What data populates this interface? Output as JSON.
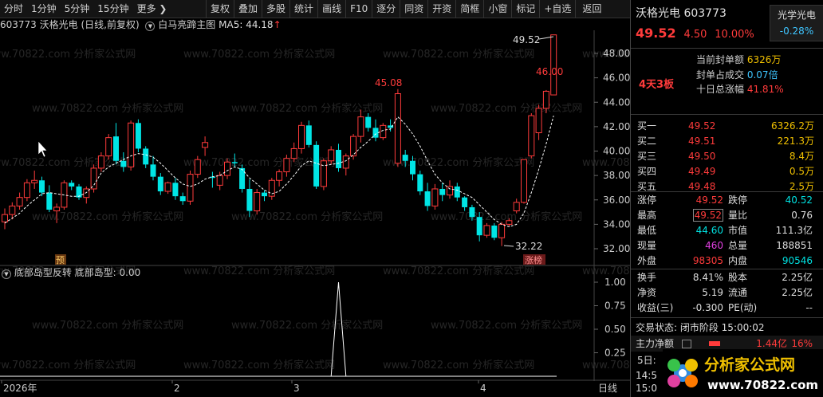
{
  "toolbar": {
    "left": [
      "分时",
      "1分钟",
      "5分钟",
      "15分钟",
      "更多 ❯"
    ],
    "right": [
      "复权",
      "叠加",
      "多股",
      "统计",
      "画线",
      "F10",
      "逐分",
      "同资",
      "开资",
      "简框",
      "小窗",
      "标记",
      "+自选",
      "返回"
    ]
  },
  "chart": {
    "code": "603773",
    "name_label": "沃格光电 (日线,前复权)",
    "formula": "白马亮蹄主图",
    "ma_label": "MA5: 44.18",
    "ma_arrow": "↑",
    "y_ticks": [
      "48.00",
      "46.00",
      "44.00",
      "42.00",
      "40.00",
      "38.00",
      "36.00",
      "34.00",
      "32.00"
    ],
    "annotations": {
      "high": "45.08",
      "top": "49.52",
      "mid": "46.00",
      "low": "32.22"
    },
    "badges": {
      "yu": "预",
      "zhangbang": "涨榜"
    }
  },
  "indicator": {
    "name": "底部岛型反转",
    "value_label": "底部岛型: 0.00",
    "y_ticks": [
      "1.00",
      "0.75",
      "0.50",
      "0.25"
    ]
  },
  "xaxis": {
    "labels": [
      "2026年",
      "2",
      "3",
      "4"
    ],
    "right_label": "日线"
  },
  "chart_data": {
    "type": "candlestick",
    "ylim": [
      31.5,
      49.5
    ],
    "ohlc": [
      [
        34.2,
        35.3,
        33.6,
        34.8
      ],
      [
        34.8,
        35.8,
        34.4,
        35.5
      ],
      [
        35.5,
        36.6,
        35.2,
        36.2
      ],
      [
        36.2,
        37.7,
        35.9,
        37.4
      ],
      [
        37.4,
        38.4,
        36.9,
        37.6
      ],
      [
        37.6,
        37.9,
        36.3,
        36.6
      ],
      [
        36.6,
        37.2,
        35.0,
        35.2
      ],
      [
        35.1,
        35.7,
        34.1,
        35.4
      ],
      [
        35.4,
        37.6,
        35.2,
        37.4
      ],
      [
        37.4,
        37.6,
        36.8,
        37.1
      ],
      [
        37.1,
        37.3,
        36.0,
        36.2
      ],
      [
        36.2,
        37.1,
        35.7,
        36.9
      ],
      [
        36.9,
        38.9,
        36.6,
        38.6
      ],
      [
        38.6,
        39.9,
        38.3,
        39.6
      ],
      [
        39.6,
        41.4,
        39.3,
        41.1
      ],
      [
        41.2,
        42.3,
        38.9,
        39.2
      ],
      [
        39.2,
        39.9,
        38.3,
        38.7
      ],
      [
        38.7,
        42.5,
        38.4,
        42.3
      ],
      [
        42.3,
        42.6,
        39.9,
        40.2
      ],
      [
        40.2,
        40.4,
        38.6,
        38.9
      ],
      [
        38.9,
        39.6,
        37.6,
        37.9
      ],
      [
        37.9,
        38.2,
        36.4,
        36.7
      ],
      [
        36.7,
        37.5,
        36.5,
        37.4
      ],
      [
        37.4,
        37.8,
        36.0,
        36.3
      ],
      [
        36.3,
        36.6,
        35.6,
        35.9
      ],
      [
        35.9,
        38.4,
        35.6,
        38.1
      ],
      [
        38.1,
        39.6,
        37.8,
        39.3
      ],
      [
        40.3,
        41.2,
        39.6,
        40.7
      ],
      [
        37.9,
        38.3,
        37.0,
        37.8
      ],
      [
        37.2,
        38.3,
        36.8,
        38.0
      ],
      [
        38.0,
        39.4,
        37.7,
        39.1
      ],
      [
        39.1,
        39.8,
        38.7,
        39.0
      ],
      [
        38.6,
        38.9,
        36.6,
        36.9
      ],
      [
        36.9,
        37.7,
        34.6,
        35.1
      ],
      [
        35.1,
        36.9,
        34.8,
        36.6
      ],
      [
        36.6,
        36.8,
        35.9,
        36.3
      ],
      [
        36.3,
        37.8,
        36.0,
        37.6
      ],
      [
        37.6,
        38.5,
        37.1,
        38.3
      ],
      [
        38.3,
        39.7,
        37.9,
        39.4
      ],
      [
        39.4,
        40.7,
        39.1,
        40.2
      ],
      [
        40.2,
        42.4,
        39.8,
        42.1
      ],
      [
        42.1,
        42.5,
        40.3,
        40.5
      ],
      [
        40.5,
        40.8,
        36.9,
        37.1
      ],
      [
        37.1,
        39.4,
        36.8,
        39.2
      ],
      [
        39.2,
        40.4,
        38.9,
        40.1
      ],
      [
        40.1,
        40.6,
        38.3,
        38.6
      ],
      [
        38.6,
        39.8,
        38.0,
        39.6
      ],
      [
        39.6,
        41.4,
        39.3,
        41.2
      ],
      [
        41.2,
        43.4,
        40.7,
        42.8
      ],
      [
        42.8,
        43.1,
        41.6,
        41.9
      ],
      [
        41.9,
        42.6,
        40.8,
        41.1
      ],
      [
        41.1,
        42.3,
        40.9,
        42.1
      ],
      [
        42.1,
        42.6,
        41.6,
        41.9
      ],
      [
        39.0,
        45.08,
        38.7,
        44.7
      ],
      [
        39.7,
        40.1,
        38.7,
        39.2
      ],
      [
        39.2,
        39.6,
        37.6,
        38.1
      ],
      [
        38.1,
        38.4,
        36.4,
        36.7
      ],
      [
        36.7,
        37.4,
        35.1,
        35.5
      ],
      [
        35.5,
        37.3,
        35.2,
        36.9
      ],
      [
        36.9,
        37.4,
        35.9,
        36.4
      ],
      [
        36.4,
        37.6,
        36.1,
        37.1
      ],
      [
        37.1,
        37.4,
        35.9,
        36.2
      ],
      [
        36.2,
        36.3,
        35.1,
        35.4
      ],
      [
        35.4,
        35.6,
        34.3,
        34.6
      ],
      [
        34.6,
        35.0,
        32.6,
        33.1
      ],
      [
        33.1,
        34.1,
        32.9,
        33.9
      ],
      [
        33.9,
        34.1,
        32.7,
        32.9
      ],
      [
        32.9,
        34.2,
        32.22,
        34.0
      ],
      [
        34.0,
        34.5,
        33.8,
        34.3
      ],
      [
        35.1,
        36.1,
        34.9,
        35.8
      ],
      [
        35.8,
        39.3,
        35.7,
        39.3
      ],
      [
        39.6,
        43.1,
        39.4,
        42.9
      ],
      [
        41.5,
        43.8,
        40.9,
        43.5
      ],
      [
        43.5,
        45.0,
        43.1,
        44.9
      ],
      [
        44.6,
        49.52,
        44.6,
        49.52
      ]
    ],
    "ma5": [
      34.1,
      34.5,
      34.9,
      35.5,
      36.0,
      36.5,
      36.6,
      36.5,
      36.4,
      36.3,
      36.3,
      36.6,
      37.2,
      38.2,
      38.7,
      39.0,
      39.3,
      39.6,
      39.8,
      39.7,
      39.5,
      39.0,
      38.4,
      37.8,
      37.3,
      37.1,
      37.3,
      37.7,
      37.9,
      38.0,
      38.4,
      38.7,
      38.5,
      37.8,
      37.3,
      36.8,
      36.5,
      36.7,
      37.3,
      38.0,
      38.8,
      39.2,
      39.0,
      38.8,
      38.9,
      39.0,
      39.2,
      39.7,
      40.3,
      40.8,
      41.4,
      41.7,
      41.8,
      42.8,
      42.2,
      41.4,
      40.4,
      39.2,
      38.1,
      37.4,
      36.9,
      36.8,
      36.5,
      36.2,
      35.6,
      35.0,
      34.4,
      34.0,
      33.8,
      34.0,
      34.9,
      36.6,
      38.5,
      40.6,
      42.9
    ],
    "indicator": {
      "name": "底部岛型",
      "values_nonzero": {
        "45": 1.0
      },
      "ylim": [
        0,
        1.1
      ]
    }
  },
  "panel": {
    "stock_name": "沃格光电",
    "code": "603773",
    "sector": "光学光电",
    "sector_change": "-0.28%",
    "price": "49.52",
    "change": "4.50",
    "pct": "10.00%",
    "streak": "4天3板",
    "seal": [
      {
        "label": "当前封单额",
        "value": "6326万"
      },
      {
        "label": "封单占成交",
        "value": "0.07倍"
      },
      {
        "label": "十日总涨幅",
        "value": "41.81%"
      }
    ],
    "orderbook": [
      {
        "name": "买一",
        "price": "49.52",
        "vol": "6326.2万"
      },
      {
        "name": "买二",
        "price": "49.51",
        "vol": "221.3万"
      },
      {
        "name": "买三",
        "price": "49.50",
        "vol": "8.4万"
      },
      {
        "name": "买四",
        "price": "49.49",
        "vol": "0.5万"
      },
      {
        "name": "买五",
        "price": "49.48",
        "vol": "2.5万"
      }
    ],
    "stats1": [
      {
        "l1": "涨停",
        "v1": "49.52",
        "l2": "跌停",
        "v2": "40.52"
      },
      {
        "l1": "最高",
        "v1": "49.52",
        "l2": "量比",
        "v2": "0.76"
      },
      {
        "l1": "最低",
        "v1": "44.60",
        "l2": "市值",
        "v2": "111.3亿"
      },
      {
        "l1": "现量",
        "v1": "460",
        "l2": "总量",
        "v2": "188851"
      },
      {
        "l1": "外盘",
        "v1": "98305",
        "l2": "内盘",
        "v2": "90546"
      }
    ],
    "stats2": [
      {
        "l1": "换手",
        "v1": "8.41%",
        "l2": "股本",
        "v2": "2.25亿"
      },
      {
        "l1": "净资",
        "v1": "5.19",
        "l2": "流通",
        "v2": "2.25亿"
      },
      {
        "l1": "收益(三)",
        "v1": "-0.300",
        "l2": "PE(动)",
        "v2": "--"
      }
    ],
    "status": "交易状态: 闭市阶段 15:00:02",
    "net_label": "主力净额",
    "net_value": "1.44亿",
    "net_pct": "16%",
    "five_day": "5日:",
    "time_rows": [
      "14:5",
      "15:0"
    ]
  },
  "logo": {
    "main": "分析家公式网",
    "url": "www.70822.com"
  },
  "watermark": "www.70822.com 分析家公式网"
}
